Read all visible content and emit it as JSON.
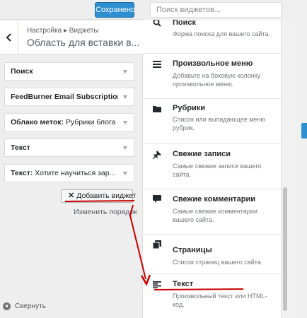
{
  "toolbar": {
    "saved_label": "Сохранено"
  },
  "header": {
    "breadcrumb": "Настройка ▸ Виджеты",
    "title": "Область для вставки в..."
  },
  "sidebar_widgets": [
    {
      "title": "Поиск",
      "subtitle": ""
    },
    {
      "title": "FeedBurner Email Subscription",
      "subtitle": ""
    },
    {
      "title": "Облако меток:",
      "subtitle": "Рубрики блога"
    },
    {
      "title": "Текст",
      "subtitle": ""
    },
    {
      "title": "Текст:",
      "subtitle": "Хотите научиться зар..."
    }
  ],
  "actions": {
    "add_widget": "Добавить виджет",
    "reorder": "Изменить порядок",
    "collapse": "Свернуть"
  },
  "search": {
    "placeholder": "Поиск виджетов..."
  },
  "available_widgets": [
    {
      "name": "Поиск",
      "desc": "Форма поиска для вашего сайта.",
      "icon": "search-icon"
    },
    {
      "name": "Произвольное меню",
      "desc": "Добавьте на боковую колонку произвольное меню.",
      "icon": "menu-icon"
    },
    {
      "name": "Рубрики",
      "desc": "Список или выпадающее меню рубрик.",
      "icon": "folder-icon"
    },
    {
      "name": "Свежие записи",
      "desc": "Самые свежие записи вашего сайта.",
      "icon": "pin-icon"
    },
    {
      "name": "Свежие комментарии",
      "desc": "Самые свежие комментарии вашего сайта.",
      "icon": "comment-icon"
    },
    {
      "name": "Страницы",
      "desc": "Список страниц вашего сайта.",
      "icon": "pages-icon"
    },
    {
      "name": "Текст",
      "desc": "Произвольный текст или HTML-код.",
      "icon": "text-icon"
    }
  ],
  "colors": {
    "accent": "#2e8fd0",
    "annotation": "#cc0000"
  }
}
